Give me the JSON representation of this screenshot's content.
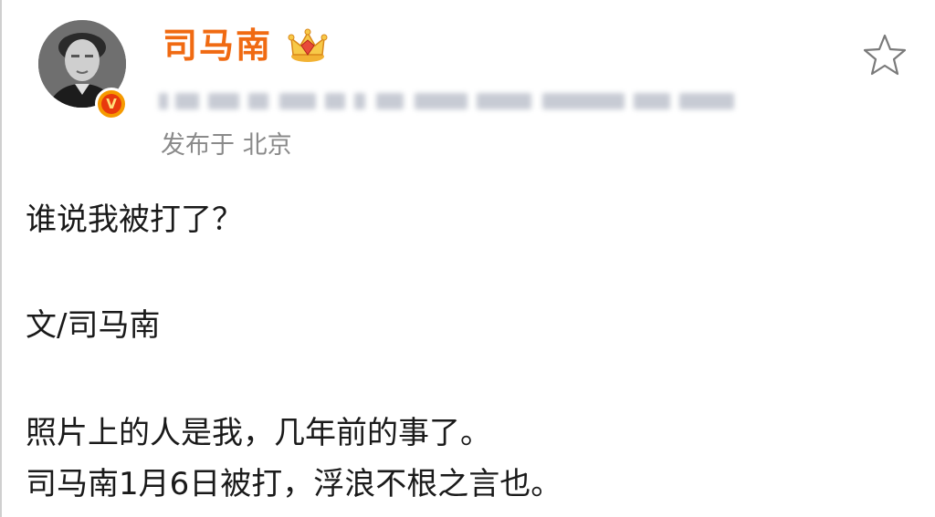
{
  "post": {
    "username": "司马南",
    "location_label": "发布于 北京",
    "verified_badge": "V",
    "lines": [
      "谁说我被打了？",
      "文/司马南",
      "照片上的人是我，几年前的事了。",
      "司马南1月6日被打，浮浪不根之言也。"
    ]
  },
  "icons": {
    "avatar": "avatar-photo",
    "badge": "verified-v-icon",
    "crown": "crown-icon",
    "star": "star-outline-icon"
  },
  "colors": {
    "username": "#f06a12",
    "location": "#8a8a8a",
    "badge_outer": "#f59a00",
    "badge_inner": "#e8390d",
    "body_text": "#1a1a1a"
  }
}
